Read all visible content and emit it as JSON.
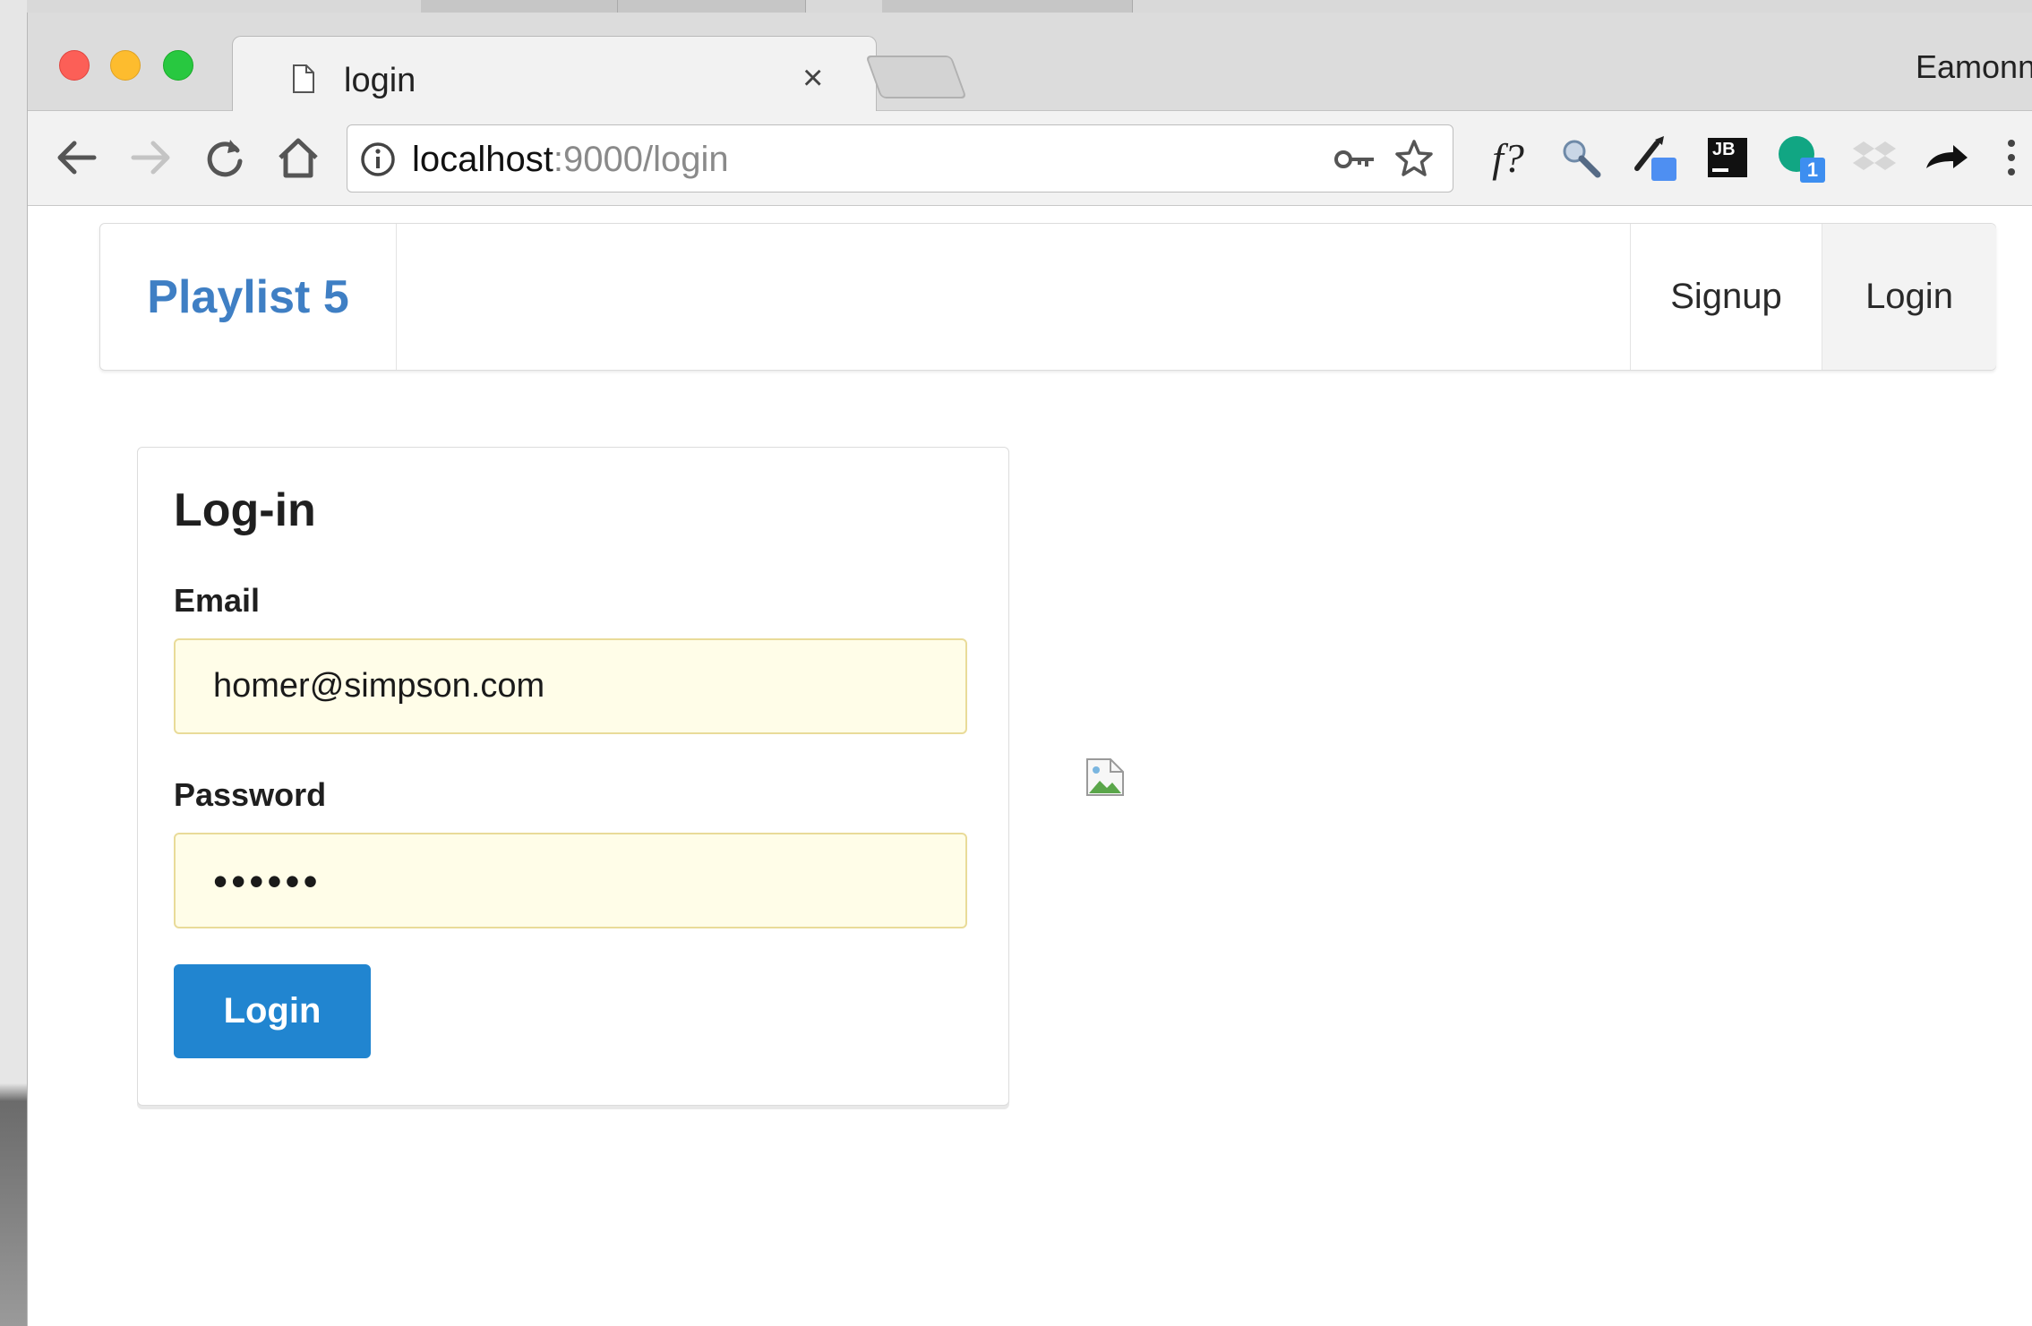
{
  "browser": {
    "tab_title": "login",
    "tab_close": "×",
    "profile_name": "Eamonn",
    "url_host": "localhost",
    "url_path": ":9000/login",
    "extensions": [
      "formula-icon",
      "magnifier-extension-icon",
      "color-picker-icon",
      "jetbrains-icon",
      "grammarly-icon",
      "dropbox-icon",
      "share-arrow-icon",
      "menu-dots-icon"
    ],
    "ext_badge": "1",
    "jetbrains_label": "JB",
    "formula_label": "f?"
  },
  "navbar": {
    "brand": "Playlist 5",
    "signup": "Signup",
    "login": "Login"
  },
  "login_form": {
    "title": "Log-in",
    "email_label": "Email",
    "email_value": "homer@simpson.com",
    "password_label": "Password",
    "password_value": "••••••",
    "submit_label": "Login"
  },
  "colors": {
    "brand": "#3f7fc4",
    "button": "#2185d0",
    "input_bg": "#fffde8"
  }
}
